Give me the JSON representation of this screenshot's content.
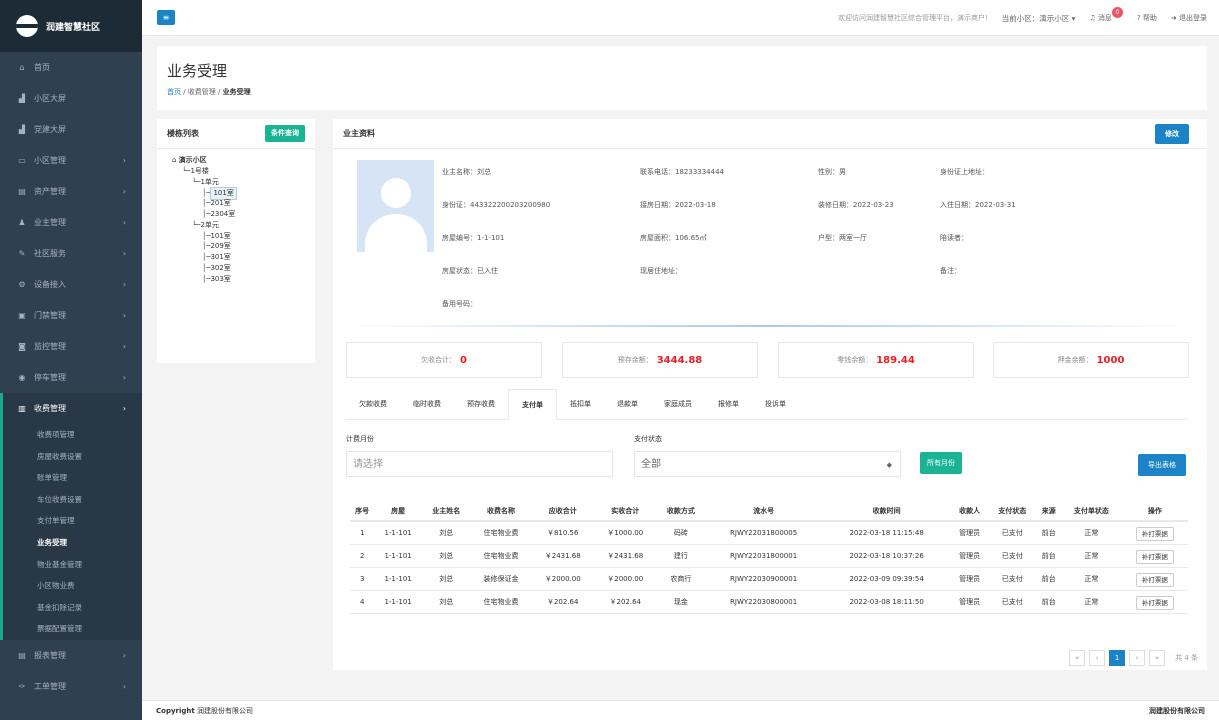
{
  "app": {
    "name": "润建智慧社区"
  },
  "nav": [
    {
      "label": "首页",
      "icon": "home-icon",
      "glyph": "⌂",
      "arrow": ""
    },
    {
      "label": "小区大屏",
      "icon": "chart-icon",
      "glyph": "▟",
      "arrow": ""
    },
    {
      "label": "党建大屏",
      "icon": "chart-icon",
      "glyph": "▟",
      "arrow": ""
    },
    {
      "label": "小区管理",
      "icon": "monitor-icon",
      "glyph": "▭",
      "arrow": "›"
    },
    {
      "label": "资产管理",
      "icon": "document-icon",
      "glyph": "▤",
      "arrow": "›"
    },
    {
      "label": "业主管理",
      "icon": "user-icon",
      "glyph": "♟",
      "arrow": "›"
    },
    {
      "label": "社区服务",
      "icon": "edit-icon",
      "glyph": "✎",
      "arrow": "›"
    },
    {
      "label": "设备接入",
      "icon": "gears-icon",
      "glyph": "⚙",
      "arrow": "›"
    },
    {
      "label": "门禁管理",
      "icon": "card-icon",
      "glyph": "▣",
      "arrow": "›"
    },
    {
      "label": "监控管理",
      "icon": "video-icon",
      "glyph": "◙",
      "arrow": "›"
    },
    {
      "label": "停车管理",
      "icon": "car-icon",
      "glyph": "◉",
      "arrow": "›"
    },
    {
      "label": "收费管理",
      "icon": "money-icon",
      "glyph": "▥",
      "arrow": "›"
    }
  ],
  "subnav": [
    "收费项管理",
    "房屋收费设置",
    "账单管理",
    "车位收费设置",
    "支付单管理",
    "业务受理",
    "物业基金管理",
    "小区物业费",
    "基金扣除记录",
    "票据配置管理"
  ],
  "nav_bottom": [
    {
      "label": "报表管理",
      "icon": "document-icon",
      "glyph": "▤",
      "arrow": "›"
    },
    {
      "label": "工单管理",
      "icon": "wrench-icon",
      "glyph": "✑",
      "arrow": "›"
    }
  ],
  "topbar": {
    "welcome": "欢迎访问润建智慧社区综合管理平台，演示商户!",
    "community": "当前小区：演示小区 ▾",
    "messages": "消息",
    "message_count": "0",
    "help": "帮助",
    "logout": "退出登录"
  },
  "page": {
    "title": "业务受理",
    "crumb_home": "首页",
    "crumb_mid": "收费管理",
    "crumb_cur": "业务受理"
  },
  "tree_panel": {
    "title": "楼栋列表",
    "button": "条件查询",
    "nodes": [
      {
        "text": "演示小区",
        "indent": 0,
        "bold": true,
        "sel": false
      },
      {
        "text": "1号楼",
        "indent": 1,
        "bold": false,
        "sel": false
      },
      {
        "text": "1单元",
        "indent": 2,
        "bold": false,
        "sel": false
      },
      {
        "text": "101室",
        "indent": 3,
        "bold": false,
        "sel": true
      },
      {
        "text": "201室",
        "indent": 3,
        "bold": false,
        "sel": false
      },
      {
        "text": "2304室",
        "indent": 3,
        "bold": false,
        "sel": false
      },
      {
        "text": "2单元",
        "indent": 2,
        "bold": false,
        "sel": false
      },
      {
        "text": "101室",
        "indent": 3,
        "bold": false,
        "sel": false
      },
      {
        "text": "209室",
        "indent": 3,
        "bold": false,
        "sel": false
      },
      {
        "text": "301室",
        "indent": 3,
        "bold": false,
        "sel": false
      },
      {
        "text": "302室",
        "indent": 3,
        "bold": false,
        "sel": false
      },
      {
        "text": "303室",
        "indent": 3,
        "bold": false,
        "sel": false
      }
    ]
  },
  "owner_panel": {
    "title": "业主资料",
    "edit": "修改"
  },
  "owner_info": [
    [
      "业主名称：刘总",
      "联系电话：18233334444",
      "性别：男",
      "身份证上地址："
    ],
    [
      "身份证：443322200203200980",
      "接房日期：2022-03-18",
      "装修日期：2022-03-23",
      "入住日期：2022-03-31"
    ],
    [
      "房屋编号：1-1-101",
      "房屋面积：106.65㎡",
      "户型：两室一厅",
      "陪读者："
    ],
    [
      "房屋状态：已入住",
      "现居住地址：",
      "",
      "备注："
    ],
    [
      "备用号码：",
      "",
      "",
      ""
    ]
  ],
  "stats": [
    {
      "label": "欠收合计：",
      "value": "0"
    },
    {
      "label": "预存余额：",
      "value": "3444.88"
    },
    {
      "label": "零钱余额：",
      "value": "189.44"
    },
    {
      "label": "押金余额：",
      "value": "1000"
    }
  ],
  "tabs": [
    "欠款收费",
    "临时收费",
    "预存收费",
    "支付单",
    "抵扣单",
    "退款单",
    "家庭成员",
    "报修单",
    "投诉单"
  ],
  "filters": {
    "month_label": "计费月份",
    "month_placeholder": "请选择",
    "status_label": "支付状态",
    "status_value": "全部",
    "all_months": "所有月份",
    "export": "导出表格"
  },
  "table": {
    "headers": [
      "序号",
      "房屋",
      "业主姓名",
      "收费名称",
      "应收合计",
      "实收合计",
      "收款方式",
      "流水号",
      "收款时间",
      "收款人",
      "支付状态",
      "来源",
      "支付单状态",
      "操作"
    ],
    "rows": [
      [
        "1",
        "1-1-101",
        "刘总",
        "住宅物业费",
        "￥810.56",
        "￥1000.00",
        "码砖",
        "RJWY22031800005",
        "2022-03-18 11:15:48",
        "管理员",
        "已支付",
        "前台",
        "正常",
        "补打票据"
      ],
      [
        "2",
        "1-1-101",
        "刘总",
        "住宅物业费",
        "￥2431.68",
        "￥2431.68",
        "建行",
        "RJWY22031800001",
        "2022-03-18 10:37:26",
        "管理员",
        "已支付",
        "前台",
        "正常",
        "补打票据"
      ],
      [
        "3",
        "1-1-101",
        "刘总",
        "装修保证金",
        "￥2000.00",
        "￥2000.00",
        "农商行",
        "RJWY22030900001",
        "2022-03-09 09:39:54",
        "管理员",
        "已支付",
        "前台",
        "正常",
        "补打票据"
      ],
      [
        "4",
        "1-1-101",
        "刘总",
        "住宅物业费",
        "￥202.64",
        "￥202.64",
        "现金",
        "RJWY22030800001",
        "2022-03-08 18:11:50",
        "管理员",
        "已支付",
        "前台",
        "正常",
        "补打票据"
      ]
    ]
  },
  "pager": {
    "first": "«",
    "prev": "‹",
    "page": "1",
    "next": "›",
    "last": "»",
    "total": "共 4 条"
  },
  "footer": {
    "left_label": "Copyright",
    "left": "润建股份有限公司",
    "right": "润建股份有限公司"
  },
  "colors": {
    "sidebar": "#2f4050",
    "accent_teal": "#1ab394",
    "accent_blue": "#1c84c6",
    "stat_red": "#ed1c24"
  }
}
